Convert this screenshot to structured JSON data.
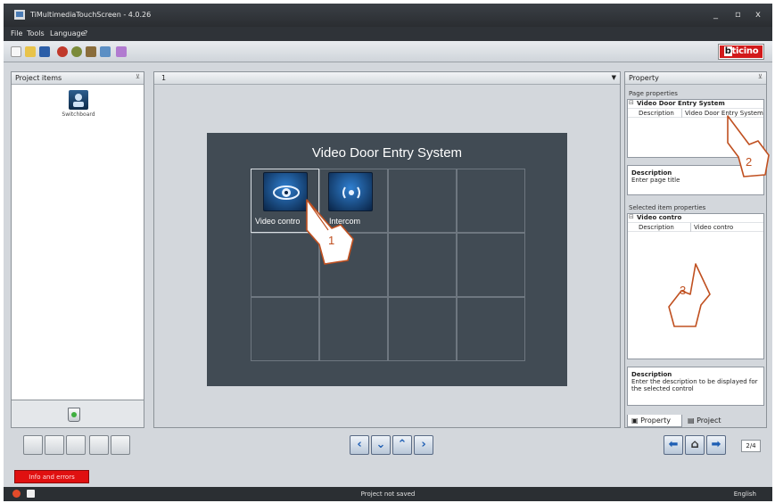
{
  "titlebar": {
    "title": "TiMultimediaTouchScreen - 4.0.26",
    "minimize": "_",
    "maximize": "▫",
    "close": "x"
  },
  "menu": {
    "file": "File",
    "tools": "Tools",
    "language": "Language",
    "help": "?"
  },
  "brand": {
    "name": "bticino",
    "prefix": "b",
    "rest": "ticino",
    "color": "#d21a1a"
  },
  "left_panel": {
    "title": "Project items",
    "item_label": "Switchboard"
  },
  "center": {
    "page_number": "1",
    "page_title": "Video Door Entry System",
    "controls": [
      {
        "label": "Video contro"
      },
      {
        "label": "Intercom"
      }
    ]
  },
  "callouts": {
    "one": "1",
    "two": "2",
    "three": "3"
  },
  "right_panel": {
    "title": "Property",
    "page_properties_label": "Page properties",
    "page_group": "Video Door Entry System",
    "page_row": {
      "key": "Description",
      "value": "Video Door Entry System"
    },
    "page_desc_title": "Description",
    "page_desc_text": "Enter page title",
    "selected_label": "Selected item properties",
    "selected_group": "Video contro",
    "selected_row": {
      "key": "Description",
      "value": "Video contro"
    },
    "sel_desc_title": "Description",
    "sel_desc_text": "Enter the description to be displayed for the selected control",
    "tabs": {
      "property": "Property",
      "project": "Project"
    }
  },
  "nav": {
    "page_count": "2/4"
  },
  "info": {
    "button": "Info and errors"
  },
  "status": {
    "center": "Project not saved",
    "language": "English"
  }
}
